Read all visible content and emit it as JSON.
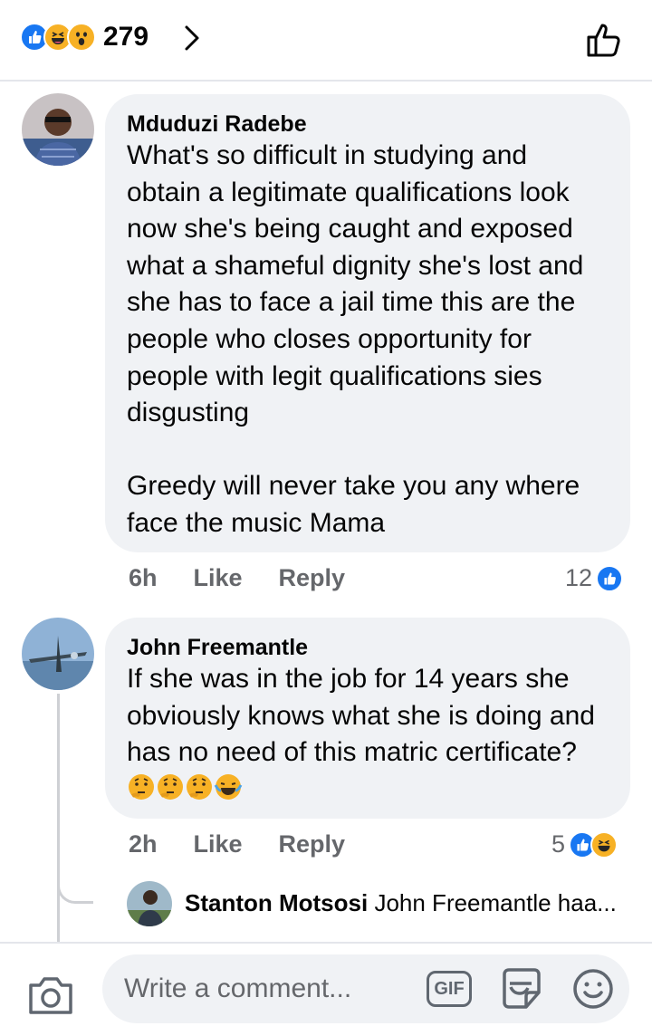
{
  "colors": {
    "accent": "#1877f2",
    "bubble": "#f0f2f5",
    "muted": "#65676b"
  },
  "header": {
    "reaction_icons": [
      "like-icon",
      "haha-icon",
      "wow-icon"
    ],
    "reaction_count": "279"
  },
  "comments": [
    {
      "author": "Mduduzi Radebe",
      "text": "What's so difficult in studying and obtain a legitimate qualifications look now she's being caught and exposed what a shameful dignity she's lost and she has to face a jail time this are the people who closes opportunity for people with legit qualifications sies disgusting\n\nGreedy will never take you any where face the music Mama",
      "time": "6h",
      "like_label": "Like",
      "reply_label": "Reply",
      "reaction_count": "12",
      "reaction_icons": [
        "like-icon"
      ]
    },
    {
      "author": "John Freemantle",
      "text": "If she was in the job for 14 years she obviously knows what she is doing and has no need of this matric certificate?",
      "emoji_icons": [
        "thinking-face-icon",
        "thinking-face-icon",
        "thinking-face-icon",
        "tears-of-joy-icon"
      ],
      "time": "2h",
      "like_label": "Like",
      "reply_label": "Reply",
      "reaction_count": "5",
      "reaction_icons": [
        "like-icon",
        "haha-icon"
      ]
    }
  ],
  "reply_preview": {
    "author": "Stanton Motsosi",
    "text": "John Freemantle haa..."
  },
  "composer": {
    "placeholder": "Write a comment...",
    "gif_label": "GIF"
  }
}
